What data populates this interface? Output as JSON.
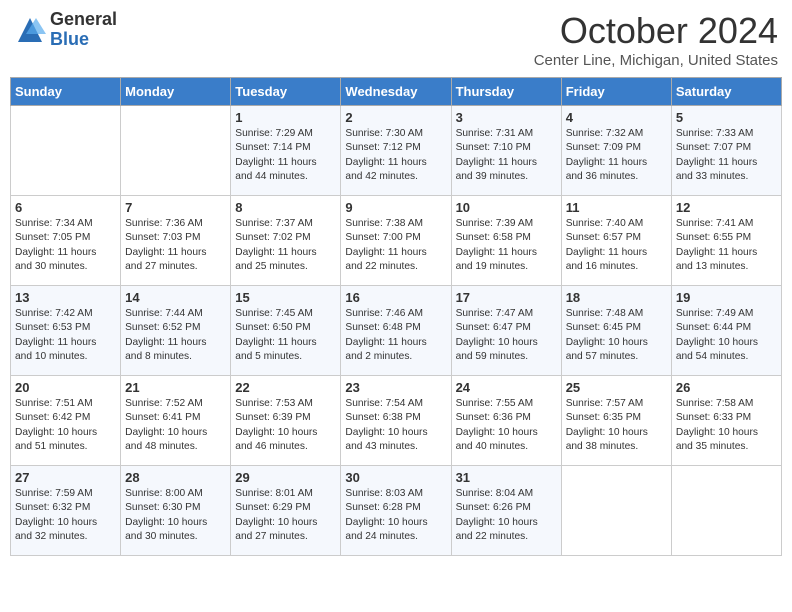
{
  "logo": {
    "general": "General",
    "blue": "Blue"
  },
  "title": "October 2024",
  "location": "Center Line, Michigan, United States",
  "days_of_week": [
    "Sunday",
    "Monday",
    "Tuesday",
    "Wednesday",
    "Thursday",
    "Friday",
    "Saturday"
  ],
  "weeks": [
    [
      {
        "day": "",
        "info": ""
      },
      {
        "day": "",
        "info": ""
      },
      {
        "day": "1",
        "info": "Sunrise: 7:29 AM\nSunset: 7:14 PM\nDaylight: 11 hours and 44 minutes."
      },
      {
        "day": "2",
        "info": "Sunrise: 7:30 AM\nSunset: 7:12 PM\nDaylight: 11 hours and 42 minutes."
      },
      {
        "day": "3",
        "info": "Sunrise: 7:31 AM\nSunset: 7:10 PM\nDaylight: 11 hours and 39 minutes."
      },
      {
        "day": "4",
        "info": "Sunrise: 7:32 AM\nSunset: 7:09 PM\nDaylight: 11 hours and 36 minutes."
      },
      {
        "day": "5",
        "info": "Sunrise: 7:33 AM\nSunset: 7:07 PM\nDaylight: 11 hours and 33 minutes."
      }
    ],
    [
      {
        "day": "6",
        "info": "Sunrise: 7:34 AM\nSunset: 7:05 PM\nDaylight: 11 hours and 30 minutes."
      },
      {
        "day": "7",
        "info": "Sunrise: 7:36 AM\nSunset: 7:03 PM\nDaylight: 11 hours and 27 minutes."
      },
      {
        "day": "8",
        "info": "Sunrise: 7:37 AM\nSunset: 7:02 PM\nDaylight: 11 hours and 25 minutes."
      },
      {
        "day": "9",
        "info": "Sunrise: 7:38 AM\nSunset: 7:00 PM\nDaylight: 11 hours and 22 minutes."
      },
      {
        "day": "10",
        "info": "Sunrise: 7:39 AM\nSunset: 6:58 PM\nDaylight: 11 hours and 19 minutes."
      },
      {
        "day": "11",
        "info": "Sunrise: 7:40 AM\nSunset: 6:57 PM\nDaylight: 11 hours and 16 minutes."
      },
      {
        "day": "12",
        "info": "Sunrise: 7:41 AM\nSunset: 6:55 PM\nDaylight: 11 hours and 13 minutes."
      }
    ],
    [
      {
        "day": "13",
        "info": "Sunrise: 7:42 AM\nSunset: 6:53 PM\nDaylight: 11 hours and 10 minutes."
      },
      {
        "day": "14",
        "info": "Sunrise: 7:44 AM\nSunset: 6:52 PM\nDaylight: 11 hours and 8 minutes."
      },
      {
        "day": "15",
        "info": "Sunrise: 7:45 AM\nSunset: 6:50 PM\nDaylight: 11 hours and 5 minutes."
      },
      {
        "day": "16",
        "info": "Sunrise: 7:46 AM\nSunset: 6:48 PM\nDaylight: 11 hours and 2 minutes."
      },
      {
        "day": "17",
        "info": "Sunrise: 7:47 AM\nSunset: 6:47 PM\nDaylight: 10 hours and 59 minutes."
      },
      {
        "day": "18",
        "info": "Sunrise: 7:48 AM\nSunset: 6:45 PM\nDaylight: 10 hours and 57 minutes."
      },
      {
        "day": "19",
        "info": "Sunrise: 7:49 AM\nSunset: 6:44 PM\nDaylight: 10 hours and 54 minutes."
      }
    ],
    [
      {
        "day": "20",
        "info": "Sunrise: 7:51 AM\nSunset: 6:42 PM\nDaylight: 10 hours and 51 minutes."
      },
      {
        "day": "21",
        "info": "Sunrise: 7:52 AM\nSunset: 6:41 PM\nDaylight: 10 hours and 48 minutes."
      },
      {
        "day": "22",
        "info": "Sunrise: 7:53 AM\nSunset: 6:39 PM\nDaylight: 10 hours and 46 minutes."
      },
      {
        "day": "23",
        "info": "Sunrise: 7:54 AM\nSunset: 6:38 PM\nDaylight: 10 hours and 43 minutes."
      },
      {
        "day": "24",
        "info": "Sunrise: 7:55 AM\nSunset: 6:36 PM\nDaylight: 10 hours and 40 minutes."
      },
      {
        "day": "25",
        "info": "Sunrise: 7:57 AM\nSunset: 6:35 PM\nDaylight: 10 hours and 38 minutes."
      },
      {
        "day": "26",
        "info": "Sunrise: 7:58 AM\nSunset: 6:33 PM\nDaylight: 10 hours and 35 minutes."
      }
    ],
    [
      {
        "day": "27",
        "info": "Sunrise: 7:59 AM\nSunset: 6:32 PM\nDaylight: 10 hours and 32 minutes."
      },
      {
        "day": "28",
        "info": "Sunrise: 8:00 AM\nSunset: 6:30 PM\nDaylight: 10 hours and 30 minutes."
      },
      {
        "day": "29",
        "info": "Sunrise: 8:01 AM\nSunset: 6:29 PM\nDaylight: 10 hours and 27 minutes."
      },
      {
        "day": "30",
        "info": "Sunrise: 8:03 AM\nSunset: 6:28 PM\nDaylight: 10 hours and 24 minutes."
      },
      {
        "day": "31",
        "info": "Sunrise: 8:04 AM\nSunset: 6:26 PM\nDaylight: 10 hours and 22 minutes."
      },
      {
        "day": "",
        "info": ""
      },
      {
        "day": "",
        "info": ""
      }
    ]
  ]
}
